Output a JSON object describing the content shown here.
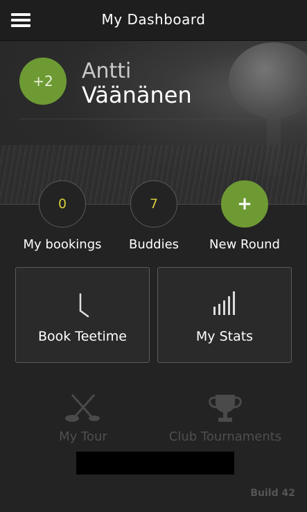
{
  "header": {
    "title": "My Dashboard",
    "menu_icon": "hamburger-menu-icon"
  },
  "profile": {
    "handicap": "+2",
    "first_name": "Antti",
    "last_name": "Väänänen"
  },
  "stats": [
    {
      "value": "0",
      "label": "My bookings"
    },
    {
      "value": "7",
      "label": "Buddies"
    },
    {
      "value": "+",
      "label": "New Round"
    }
  ],
  "tiles": [
    {
      "label": "Book Teetime",
      "icon": "clock-icon"
    },
    {
      "label": "My Stats",
      "icon": "bar-chart-icon"
    }
  ],
  "secondary": [
    {
      "label": "My Tour",
      "icon": "golf-clubs-icon"
    },
    {
      "label": "Club Tournaments",
      "icon": "trophy-icon"
    }
  ],
  "footer": {
    "build": "Build 42"
  },
  "colors": {
    "accent": "#6e9a34",
    "count_text": "#d7cc3c",
    "background": "#232323"
  }
}
